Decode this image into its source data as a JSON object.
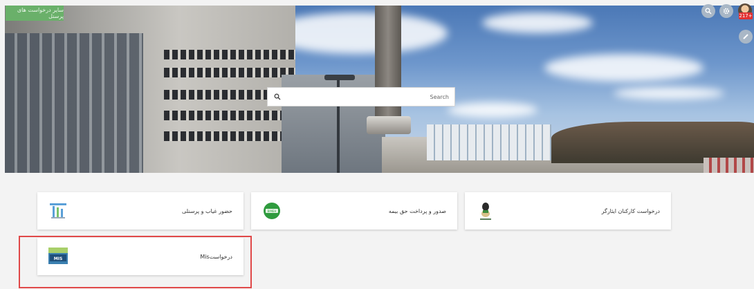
{
  "header": {
    "tag_label": "سایر درخواست های پرسنل",
    "notification_count": "217+"
  },
  "search": {
    "placeholder": "Search"
  },
  "cards": [
    {
      "label": "حضور غیاب و پرسنلی",
      "icon": "attendance-icon"
    },
    {
      "label": "صدور و پرداخت حق بیمه",
      "icon": "insurance-icon"
    },
    {
      "label": "درخواست کارکنان ایثارگر",
      "icon": "veterans-icon"
    },
    {
      "label": "درخواستMis",
      "icon": "mis-icon"
    }
  ],
  "colors": {
    "tag_bg": "#6ab06a",
    "badge_bg": "#e23232",
    "highlight_border": "#e04848"
  }
}
